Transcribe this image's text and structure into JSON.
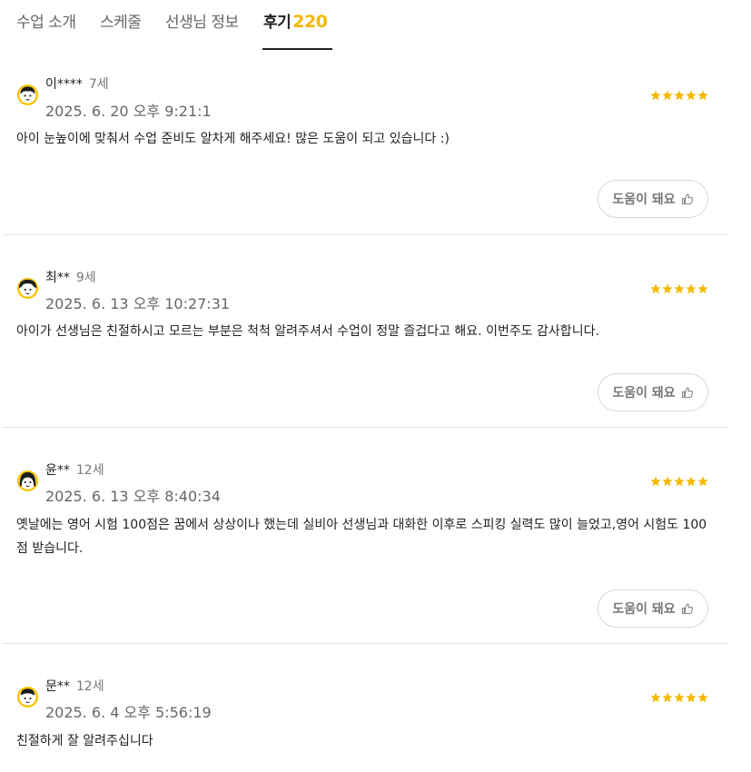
{
  "tabs": [
    {
      "label": "수업 소개"
    },
    {
      "label": "스케줄"
    },
    {
      "label": "선생님 정보"
    },
    {
      "label": "후기",
      "count": "220"
    }
  ],
  "helpful_label": "도움이 돼요",
  "reviews": [
    {
      "name": "이****",
      "age": "7세",
      "date": "2025. 6. 20 오후 9:21:1",
      "rating": 5,
      "text": "아이 눈높이에 맞춰서 수업 준비도 알차게 해주세요! 많은 도움이 되고 있습니다 :)"
    },
    {
      "name": "최**",
      "age": "9세",
      "date": "2025. 6. 13 오후 10:27:31",
      "rating": 5,
      "text": "아이가 선생님은 친절하시고 모르는 부분은 척척 알려주셔서 수업이 정말 즐겁다고 해요. 이번주도 감사합니다."
    },
    {
      "name": "윤**",
      "age": "12세",
      "date": "2025. 6. 13 오후 8:40:34",
      "rating": 5,
      "text": "옛날에는 영어 시험 100점은 꿈에서 상상이나 했는데 실비아 선생님과 대화한 이후로 스피킹 실력도 많이 늘었고,영어 시험도 100점 받습니다."
    },
    {
      "name": "문**",
      "age": "12세",
      "date": "2025. 6. 4 오후 5:56:19",
      "rating": 5,
      "text": "친절하게 잘 알려주십니다"
    }
  ],
  "colors": {
    "star": "#f5b800",
    "accent_count": "#f5b800",
    "avatar_ring": "#f7c600"
  },
  "icons": {
    "star": "star-icon",
    "thumb": "thumbs-up-icon",
    "avatar": "avatar-icon"
  }
}
